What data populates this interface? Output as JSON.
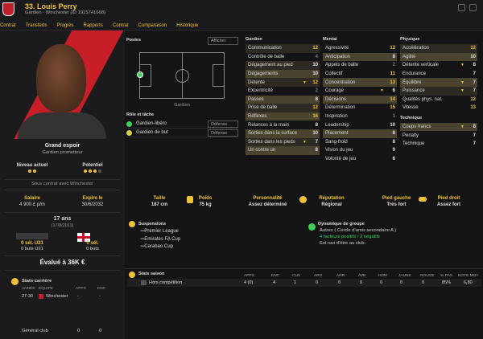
{
  "header": {
    "name": "33. Louis Perry",
    "subtitle": "Gardien - Winchester (ID 1915741668)"
  },
  "nav": [
    "Contrat",
    "Transferts",
    "Progrès",
    "Rapports",
    "Contrat",
    "Comparaison",
    "Historique"
  ],
  "profile": {
    "title": "Grand espoir",
    "subtitle": "Gardien prometteur",
    "current_label": "Niveau actuel",
    "current_stars": 2,
    "potential_label": "Potentiel",
    "potential_stars": 3,
    "contract_status": "Sous contrat avec Winchester",
    "salary_label": "Salaire",
    "salary": "4 900 £ p/m",
    "expiry_label": "Expire le",
    "expiry": "30/6/2032",
    "age": "17 ans",
    "dob": "(17/8/2011)",
    "u21_left_label": "0 sél. U21",
    "u21_left_sub": "0 buts U21",
    "u21_right_label": "0 sél.",
    "u21_right_sub": "0 buts",
    "value_label": "Évalué à 36K €",
    "career_stats_title": "Stats carrière",
    "career_cols": [
      "ANNÉE",
      "ÉQUIPE",
      "APPS",
      "ENC"
    ],
    "career_row": [
      "27-30",
      "Winchester",
      "-",
      "-"
    ],
    "general_club": "Général club",
    "general_apps": "0",
    "general_enc": "0"
  },
  "positions": {
    "title": "Postes",
    "show_btn": "Afficher",
    "pos_label": "Gardien",
    "roles_title": "Rôle et tâche",
    "roles": [
      {
        "name": "Gardien-libéro",
        "duty": "Défense",
        "color": "#3dd05a"
      },
      {
        "name": "Gardien de but",
        "duty": "Défense",
        "color": "#d8d04a"
      }
    ]
  },
  "attributes": {
    "gardien": {
      "title": "Gardien",
      "rows": [
        [
          "Communication",
          "12"
        ],
        [
          "Contrôle de balle",
          "4"
        ],
        [
          "Dégagement au pied",
          "10"
        ],
        [
          "Dégagements",
          "10"
        ],
        [
          "Détente",
          "12"
        ],
        [
          "Excentricité",
          "2"
        ],
        [
          "Passes",
          "8"
        ],
        [
          "Prise de balle",
          "12"
        ],
        [
          "Réflexes",
          "16"
        ],
        [
          "Relances à la main",
          "8"
        ],
        [
          "Sorties dans la surface",
          "10"
        ],
        [
          "Sorties dans les pieds",
          "7"
        ],
        [
          "Un contre un",
          "8"
        ]
      ]
    },
    "mental": {
      "title": "Mental",
      "rows": [
        [
          "Agressivité",
          "12"
        ],
        [
          "Anticipation",
          "8"
        ],
        [
          "Appels de balle",
          "2"
        ],
        [
          "Collectif",
          "11"
        ],
        [
          "Concentration",
          "13"
        ],
        [
          "Courage",
          "6"
        ],
        [
          "Décisions",
          "14"
        ],
        [
          "Détermination",
          "15"
        ],
        [
          "Inspiration",
          "1"
        ],
        [
          "Leadership",
          "10"
        ],
        [
          "Placement",
          "8"
        ],
        [
          "Sang-froid",
          "8"
        ],
        [
          "Vision du jeu",
          "9"
        ],
        [
          "Volonté de jeu",
          "6"
        ]
      ]
    },
    "physique": {
      "title": "Physique",
      "rows": [
        [
          "Accélération",
          "12"
        ],
        [
          "Agilité",
          "10"
        ],
        [
          "Détente verticale",
          "8"
        ],
        [
          "Endurance",
          "7"
        ],
        [
          "Équilibre",
          "7"
        ],
        [
          "Puissance",
          "7"
        ],
        [
          "Qualités phys. nat.",
          "12"
        ],
        [
          "Vitesse",
          "13"
        ]
      ]
    },
    "technique": {
      "title": "Technique",
      "rows": [
        [
          "Coups francs",
          "8"
        ],
        [
          "Penalty",
          "7"
        ],
        [
          "Technique",
          "7"
        ]
      ]
    }
  },
  "info": {
    "taille_label": "Taille",
    "taille": "187 cm",
    "poids_label": "Poids",
    "poids": "75 kg",
    "perso_label": "Personnalité",
    "perso": "Assez déterminé",
    "rep_label": "Réputation",
    "rep": "Régional",
    "pg_label": "Pied gauche",
    "pg": "Très fort",
    "pd_label": "Pied droit",
    "pd": "Assez fort"
  },
  "suspensions": {
    "title": "Suspensions",
    "items": [
      "Premier League",
      "Emirates FA Cup",
      "Carabao Cup"
    ]
  },
  "group": {
    "title": "Dynamique de groupe",
    "line1": "Autres ( Cercle d'amis secondaire A )",
    "line2": "4 facteurs positifs / 2 négatifs",
    "line3": "Est ravi d'être au club."
  },
  "season": {
    "title": "Stats saison",
    "cols": [
      "APPS",
      "ENC",
      "CLN",
      "ARG",
      "ARR",
      "AVB",
      "HDM",
      "JAUNE",
      "ROUGE",
      "% PAS.",
      "NOTE MOY"
    ],
    "row_label": "Hors compétition",
    "row": [
      "4 (0)",
      "4",
      "1",
      "0",
      "0",
      "0",
      "0",
      "0",
      "0",
      "85%",
      "6,80"
    ]
  }
}
